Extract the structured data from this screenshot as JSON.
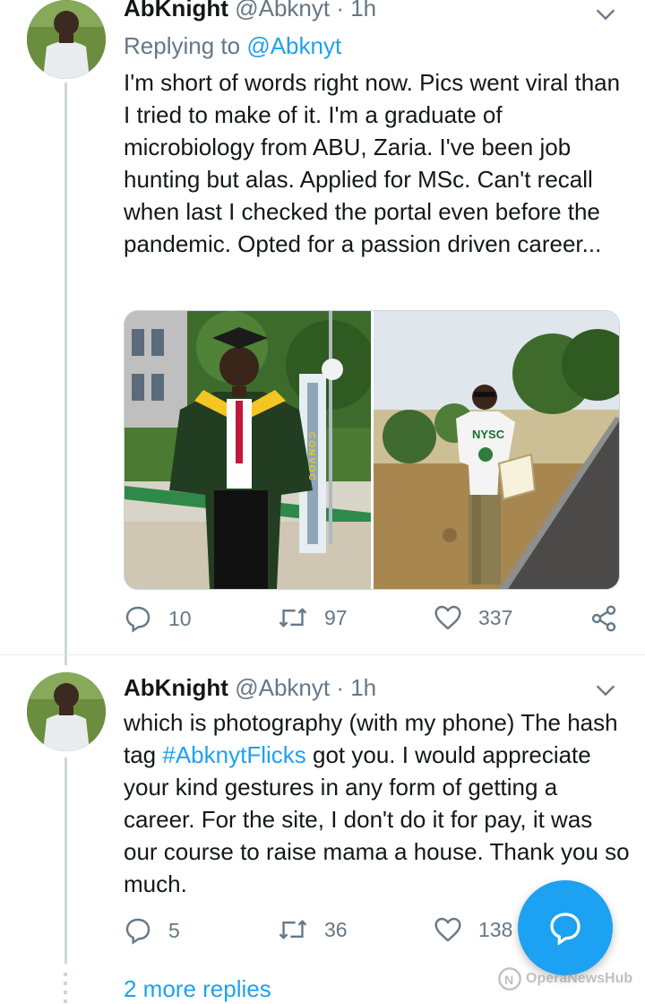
{
  "tweets": [
    {
      "name": "AbKnight",
      "handle": "@Abknyt",
      "time": "· 1h",
      "replying_prefix": "Replying to ",
      "replying_to": "@Abknyt",
      "text": "I'm short of words right now. Pics went viral than I tried to make of it. I'm a graduate of microbiology from ABU, Zaria. I've been job hunting but alas. Applied for MSc. Can't recall when last I checked the portal even before the pandemic. Opted for a passion driven career...",
      "media": [
        {
          "alt": "graduation-photo",
          "banner_text": "CONVOC"
        },
        {
          "alt": "nysc-photo",
          "shirt_text": "NYSC"
        }
      ],
      "replies": "10",
      "retweets": "97",
      "likes": "337"
    },
    {
      "name": "AbKnight",
      "handle": "@Abknyt",
      "time": "· 1h",
      "text_part1": "which is photography (with my phone) The hash tag ",
      "hashtag": "#AbknytFlicks",
      "text_part2": " got you. I would appreciate your kind gestures in any form of getting a career. For the site,  I don't do it for pay,  it was our course to raise mama a house. Thank you so much.",
      "replies": "5",
      "retweets": "36",
      "likes": "138"
    }
  ],
  "more_replies": "2 more replies",
  "watermark": "OperaNewsHub",
  "colors": {
    "accent": "#1da1f2",
    "muted": "#657786",
    "thread_line": "#ccd6dd"
  },
  "icons": [
    "reply-icon",
    "retweet-icon",
    "like-icon",
    "share-icon",
    "chevron-down-icon",
    "compose-reply-icon"
  ]
}
